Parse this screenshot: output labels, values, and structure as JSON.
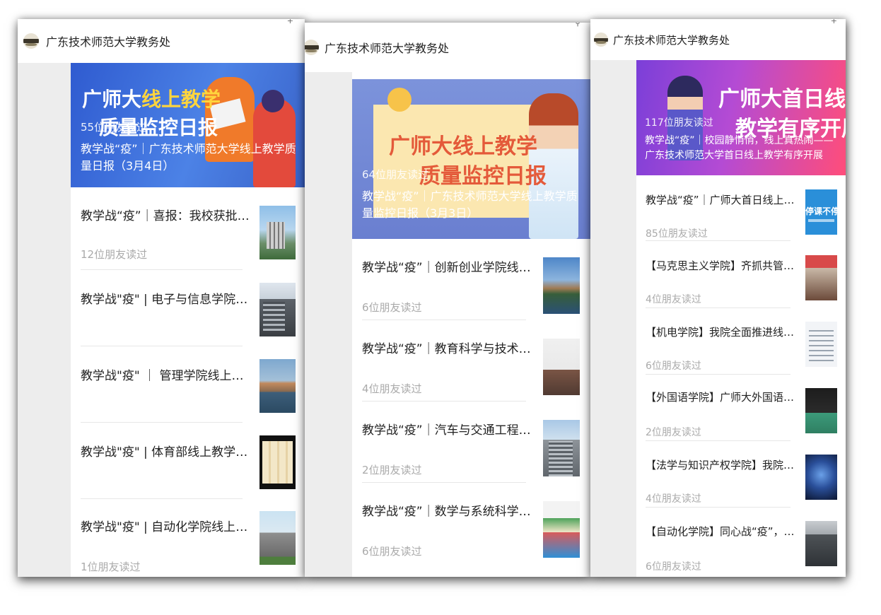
{
  "publisher_name": "广东技术师范大学教务处",
  "panels": [
    {
      "hero": {
        "title_line1_prefix": "广师大",
        "title_line1_accent": "线上教学",
        "title_line2": "质量监控日报",
        "readers": "55位朋友读过",
        "caption": "教学战“疫”｜广东技术师范大学线上教学质量日报（3月4日）"
      },
      "articles": [
        {
          "title": "教学战“疫”｜喜报：我校获批三个...",
          "readers": "12位朋友读过",
          "thumb": "building-photo"
        },
        {
          "title": "教学战\"疫\" | 电子与信息学院线上教...",
          "readers": "",
          "thumb": "building-photo"
        },
        {
          "title": "教学战\"疫\" ｜ 管理学院线上教学质...",
          "readers": "",
          "thumb": "lake-building-photo"
        },
        {
          "title": "教学战\"疫\" | 体育部线上教学质量监...",
          "readers": "",
          "thumb": "tablet-photo"
        },
        {
          "title": "教学战\"疫\" | 自动化学院线上教学质...",
          "readers": "1位朋友读过",
          "thumb": "building-photo"
        }
      ]
    },
    {
      "hero": {
        "title_line1": "广师大线上教学",
        "title_line2": "质量监控日报",
        "readers": "64位朋友读过",
        "caption": "教学战“疫”｜广东技术师范大学线上教学质量监控日报（3月3日）"
      },
      "articles": [
        {
          "title": "教学战“疫”｜创新创业学院线上教...",
          "readers": "6位朋友读过",
          "thumb": "campus-photo"
        },
        {
          "title": "教学战“疫”｜教育科学与技术学院...",
          "readers": "4位朋友读过",
          "thumb": "classroom-photo"
        },
        {
          "title": "教学战“疫”｜汽车与交通工程学院...",
          "readers": "2位朋友读过",
          "thumb": "building-photo"
        },
        {
          "title": "教学战“疫”｜数学与系统科学学院...",
          "readers": "6位朋友读过",
          "thumb": "building-photo"
        }
      ]
    },
    {
      "hero": {
        "title_line1": "广师大首日线上",
        "title_line2": "教学有序开展",
        "readers": "117位朋友读过",
        "caption": "教学战“疫”｜校园静悄悄，线上真热闹——广东技术师范大学首日线上教学有序开展"
      },
      "articles": [
        {
          "title": "教学战“疫”｜广师大首日线上教学...",
          "readers": "85位朋友读过",
          "thumb": "banner-image",
          "thumb_text": "停课不停学"
        },
        {
          "title": "【马克思主义学院】齐抓共管、多...",
          "readers": "4位朋友读过",
          "thumb": "meeting-photo"
        },
        {
          "title": "【机电学院】我院全面推进线上教...",
          "readers": "6位朋友读过",
          "thumb": "document-image"
        },
        {
          "title": "【外国语学院】广师大外国语，开...",
          "readers": "2位朋友读过",
          "thumb": "screen-photo"
        },
        {
          "title": "【法学与知识产权学院】我院在线...",
          "readers": "4位朋友读过",
          "thumb": "stage-photo"
        },
        {
          "title": "【自动化学院】同心战“疫”，多...",
          "readers": "6位朋友读过",
          "thumb": "building-photo"
        }
      ]
    }
  ],
  "colors": {
    "hero1_bg": "#3f6fd4",
    "hero1_accent": "#ffd53d",
    "hero2_bg": "#6f87d6",
    "hero2_title": "#e45a3a",
    "hero3_bg_start": "#7b3fd8",
    "hero3_bg_end": "#ff4d7a",
    "readers_gray": "#aaaaaa"
  }
}
